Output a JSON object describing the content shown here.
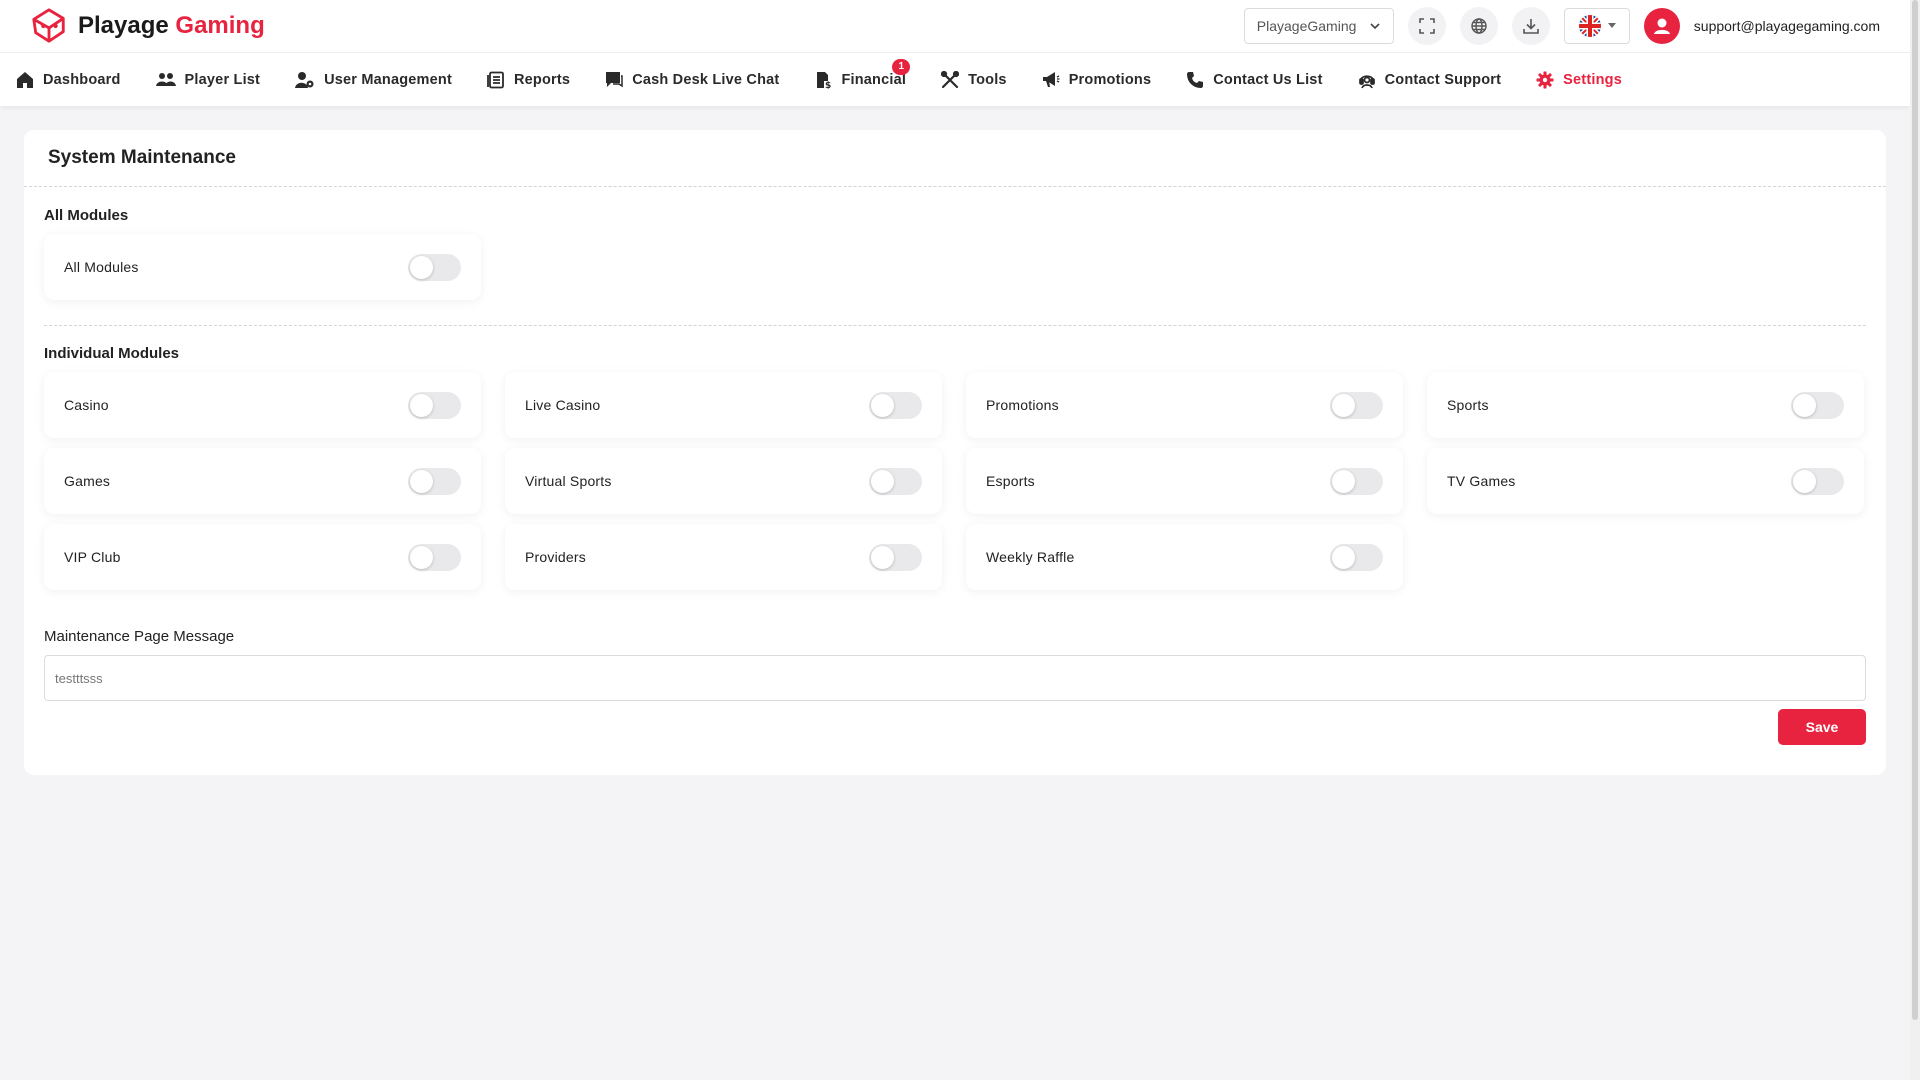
{
  "brand": {
    "name_part1": "Playage",
    "name_part2": "Gaming"
  },
  "header": {
    "site_select": "PlayageGaming",
    "user_email": "support@playagegaming.com",
    "icons": [
      "fullscreen-icon",
      "globe-icon",
      "download-icon",
      "uk-flag-icon",
      "user-icon"
    ]
  },
  "nav": {
    "items": [
      {
        "label": "Dashboard",
        "icon": "home-icon"
      },
      {
        "label": "Player List",
        "icon": "users-icon"
      },
      {
        "label": "User Management",
        "icon": "user-gear-icon"
      },
      {
        "label": "Reports",
        "icon": "report-icon"
      },
      {
        "label": "Cash Desk Live Chat",
        "icon": "chat-icon"
      },
      {
        "label": "Financial",
        "icon": "financial-icon",
        "badge": "1"
      },
      {
        "label": "Tools",
        "icon": "tools-icon"
      },
      {
        "label": "Promotions",
        "icon": "megaphone-icon"
      },
      {
        "label": "Contact Us List",
        "icon": "phone-icon"
      },
      {
        "label": "Contact Support",
        "icon": "support-icon"
      },
      {
        "label": "Settings",
        "icon": "gear-icon",
        "active": true
      }
    ]
  },
  "page": {
    "title": "System Maintenance",
    "all_modules_title": "All Modules",
    "all_modules": [
      {
        "label": "All Modules",
        "enabled": false
      }
    ],
    "individual_title": "Individual Modules",
    "modules": [
      {
        "label": "Casino",
        "enabled": false
      },
      {
        "label": "Live Casino",
        "enabled": false
      },
      {
        "label": "Promotions",
        "enabled": false
      },
      {
        "label": "Sports",
        "enabled": false
      },
      {
        "label": "Games",
        "enabled": false
      },
      {
        "label": "Virtual Sports",
        "enabled": false
      },
      {
        "label": "Esports",
        "enabled": false
      },
      {
        "label": "TV Games",
        "enabled": false
      },
      {
        "label": "VIP Club",
        "enabled": false
      },
      {
        "label": "Providers",
        "enabled": false
      },
      {
        "label": "Weekly Raffle",
        "enabled": false
      }
    ],
    "message_label": "Maintenance Page Message",
    "message_value": "testttsss",
    "save_label": "Save"
  },
  "colors": {
    "accent": "#e8233f"
  }
}
